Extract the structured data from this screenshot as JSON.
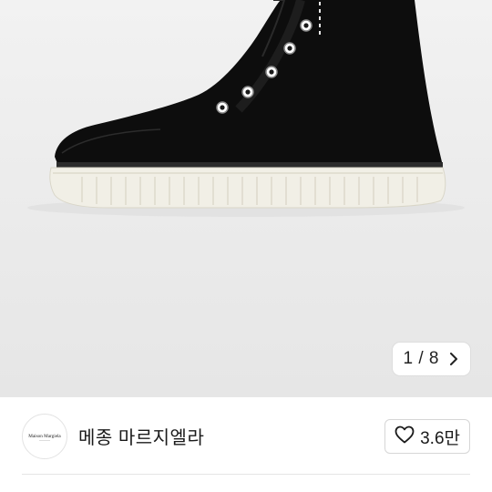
{
  "product_image": {
    "pager": {
      "current": "1",
      "separator": "/",
      "total": "8",
      "text": "1 / 8"
    }
  },
  "brand": {
    "name": "메종 마르지엘라",
    "logo_text": "Maison Margiela"
  },
  "like": {
    "count": "3.6만",
    "icon": "heart-outline-icon"
  },
  "icons": {
    "next": "chevron-right-icon",
    "like": "heart-outline-icon"
  },
  "colors": {
    "hero_bg": "#ececec",
    "shoe_upper": "#0d0d0d",
    "sole": "#f1efe6",
    "text": "#1a1a1a"
  }
}
